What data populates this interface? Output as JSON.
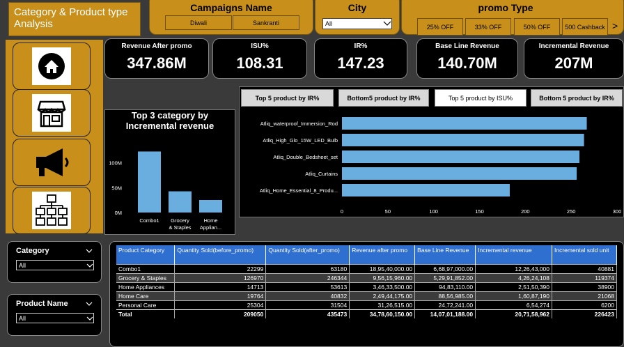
{
  "header": {
    "title": "Category  & Product type Analysis",
    "campaigns": {
      "title": "Campaigns Name",
      "options": [
        "Diwali",
        "Sankranti"
      ]
    },
    "city": {
      "title": "City",
      "value": "All",
      "chevron": "chevron-down-icon"
    },
    "promo": {
      "title": "promo Type",
      "options": [
        "25% OFF",
        "33% OFF",
        "50% OFF",
        "500 Cashback"
      ],
      "next": ">"
    }
  },
  "nav": [
    "home-icon",
    "store-icon",
    "megaphone-icon",
    "hierarchy-icon"
  ],
  "kpis": [
    {
      "label": "Revenue After promo",
      "value": "347.86M"
    },
    {
      "label": "ISU%",
      "value": "108.31"
    },
    {
      "label": "IR%",
      "value": "147.23"
    },
    {
      "label": "Base Line Revenue",
      "value": "140.70M"
    },
    {
      "label": "Incremental Revenue",
      "value": "207M"
    }
  ],
  "tabs": [
    "Top 5 product by IR%",
    "Bottom5 product by IR%",
    "Top 5 product by ISU%",
    "Bottom 5 product by IR%"
  ],
  "active_tab": 2,
  "filters": {
    "category": {
      "label": "Category",
      "value": "All"
    },
    "product": {
      "label": "Product Name",
      "value": "All"
    }
  },
  "colors": {
    "accent": "#c8901b",
    "bar": "#6aaee0",
    "table_header": "#2f6fd0"
  },
  "chart_data": [
    {
      "type": "bar",
      "title": "Top 3 category by Incremental revenue",
      "categories": [
        "Combo1",
        "Grocery & Staples",
        "Home Applian..."
      ],
      "values": [
        122.6,
        42.6,
        25.2
      ],
      "yticks": [
        "0M",
        "50M",
        "100M"
      ],
      "ylim": [
        0,
        140
      ]
    },
    {
      "type": "bar",
      "orientation": "horizontal",
      "categories": [
        "Atliq_waterproof_Immersion_Rod",
        "Atliq_High_Glo_15W_LED_Bulb",
        "Atliq_Double_Bedsheet_set",
        "Atliq_Curtains",
        "Atliq_Home_Essential_8_Produ..."
      ],
      "values": [
        267,
        264,
        259,
        256,
        183
      ],
      "xticks": [
        "0",
        "50",
        "100",
        "150",
        "200",
        "250",
        "300"
      ],
      "xlim": [
        0,
        300
      ]
    }
  ],
  "table": {
    "columns": [
      "Product Category",
      "Quantity Sold(before_promo)",
      "Quantity Sold(after_promo)",
      "Revenue after promo",
      "Base Line Revenue",
      "Incremental revenue",
      "Incremental sold unit"
    ],
    "rows": [
      [
        "Combo1",
        "22299",
        "63180",
        "18,95,40,000.00",
        "6,68,97,000.00",
        "12,26,43,000",
        "40881"
      ],
      [
        "Grocery & Staples",
        "126970",
        "246344",
        "9,56,15,960.00",
        "5,29,91,852.00",
        "4,26,24,108",
        "119374"
      ],
      [
        "Home Appliances",
        "14713",
        "53613",
        "3,46,33,500.00",
        "94,83,110.00",
        "2,51,50,390",
        "38900"
      ],
      [
        "Home Care",
        "19764",
        "40832",
        "2,49,44,175.00",
        "88,56,985.00",
        "1,60,87,190",
        "21068"
      ],
      [
        "Personal Care",
        "25304",
        "31504",
        "31,26,515.00",
        "24,72,241.00",
        "6,54,274",
        "6200"
      ]
    ],
    "total": [
      "Total",
      "209050",
      "435473",
      "34,78,60,150.00",
      "14,07,01,188.00",
      "20,71,58,962",
      "226423"
    ]
  }
}
